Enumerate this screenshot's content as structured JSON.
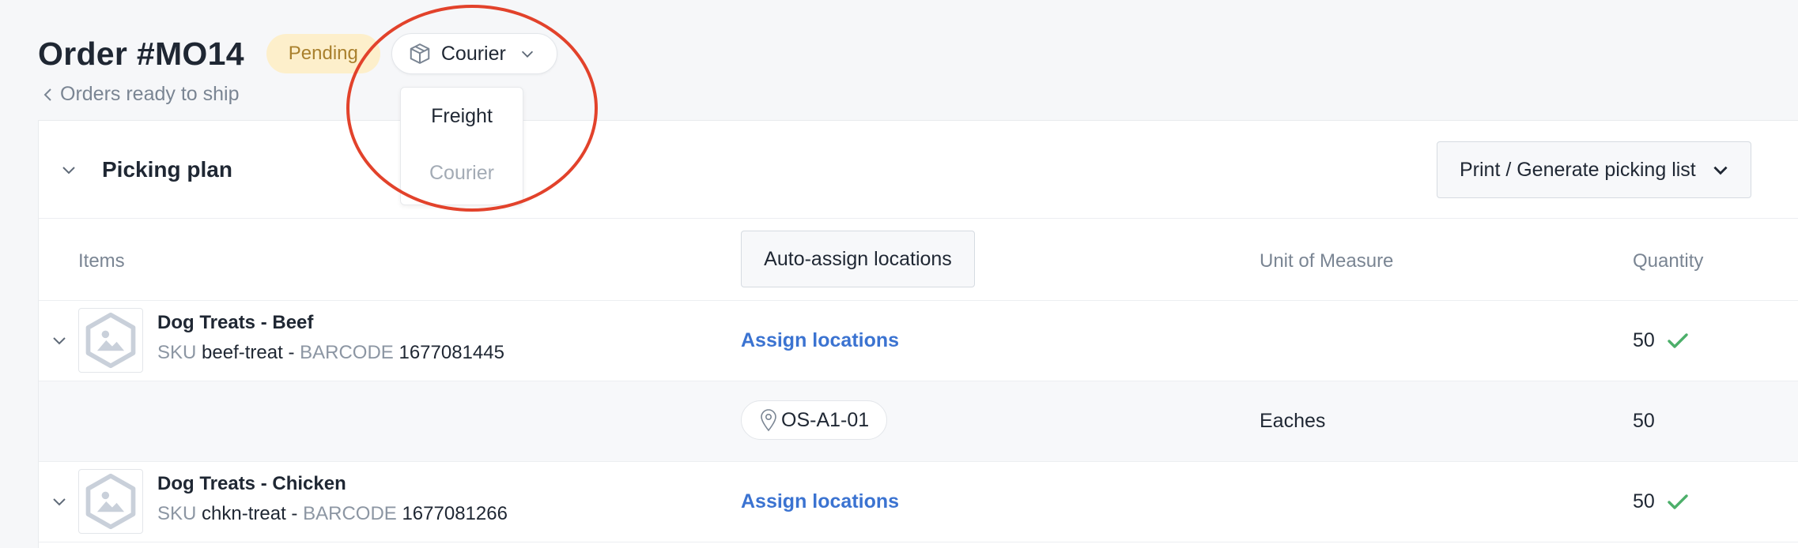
{
  "header": {
    "order_title": "Order #MO14",
    "status": "Pending",
    "shipping_method": "Courier",
    "breadcrumb": "Orders ready to ship"
  },
  "shipping_dropdown": {
    "options": [
      "Freight",
      "Courier"
    ]
  },
  "picking_plan": {
    "title": "Picking plan",
    "print_button": "Print / Generate picking list",
    "columns": {
      "items": "Items",
      "auto_assign": "Auto-assign locations",
      "uom": "Unit of Measure",
      "quantity": "Quantity"
    },
    "rows": [
      {
        "name": "Dog Treats - Beef",
        "sku_label": "SKU",
        "sku": "beef-treat",
        "separator": "-",
        "barcode_label": "BARCODE",
        "barcode": "1677081445",
        "action": "Assign locations",
        "quantity": "50",
        "location": {
          "code": "OS-A1-01",
          "uom": "Eaches",
          "quantity": "50"
        }
      },
      {
        "name": "Dog Treats - Chicken",
        "sku_label": "SKU",
        "sku": "chkn-treat",
        "separator": "-",
        "barcode_label": "BARCODE",
        "barcode": "1677081266",
        "action": "Assign locations",
        "quantity": "50"
      }
    ]
  },
  "colors": {
    "accent_link": "#3b73d1",
    "status_bg": "#fdefcb",
    "status_text": "#a9802d",
    "check_green": "#4caf6a",
    "annotation_red": "#e2422b"
  }
}
